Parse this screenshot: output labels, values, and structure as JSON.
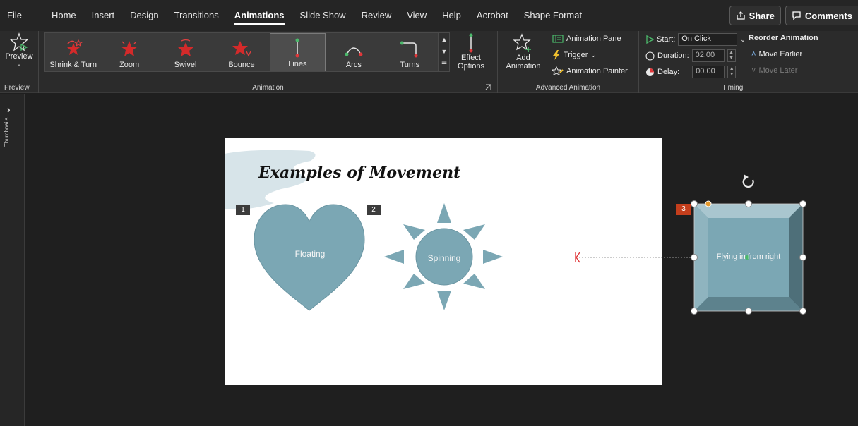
{
  "menu": {
    "tabs": [
      "File",
      "Home",
      "Insert",
      "Design",
      "Transitions",
      "Animations",
      "Slide Show",
      "Review",
      "View",
      "Help",
      "Acrobat",
      "Shape Format"
    ],
    "active": "Animations",
    "share": "Share",
    "comments": "Comments"
  },
  "ribbon": {
    "preview": {
      "label": "Preview",
      "group": "Preview"
    },
    "animation_group": "Animation",
    "gallery": [
      {
        "label": "Shrink & Turn",
        "icon": "shrink-turn-star-icon"
      },
      {
        "label": "Zoom",
        "icon": "zoom-star-icon"
      },
      {
        "label": "Swivel",
        "icon": "swivel-star-icon"
      },
      {
        "label": "Bounce",
        "icon": "bounce-star-icon"
      },
      {
        "label": "Lines",
        "icon": "lines-path-icon",
        "selected": true
      },
      {
        "label": "Arcs",
        "icon": "arcs-path-icon"
      },
      {
        "label": "Turns",
        "icon": "turns-path-icon"
      }
    ],
    "effect_options": {
      "line1": "Effect",
      "line2": "Options"
    },
    "advanced": {
      "group": "Advanced Animation",
      "add_line1": "Add",
      "add_line2": "Animation",
      "pane": "Animation Pane",
      "trigger": "Trigger",
      "painter": "Animation Painter"
    },
    "timing": {
      "group": "Timing",
      "start_label": "Start:",
      "start_value": "On Click",
      "duration_label": "Duration:",
      "duration_value": "02.00",
      "delay_label": "Delay:",
      "delay_value": "00.00",
      "reorder": "Reorder Animation",
      "earlier": "Move Earlier",
      "later": "Move Later"
    }
  },
  "thumbs": {
    "label": "Thumbnails"
  },
  "slide": {
    "title": "Examples of Movement",
    "badge1": "1",
    "badge2": "2",
    "badge3": "3",
    "heart_text": "Floating",
    "sun_text": "Spinning",
    "square_text": "Flying in from right"
  },
  "colors": {
    "shape_fill": "#7ba7b4",
    "accent_red": "#e0373a",
    "badge_orange": "#c43e1c"
  }
}
